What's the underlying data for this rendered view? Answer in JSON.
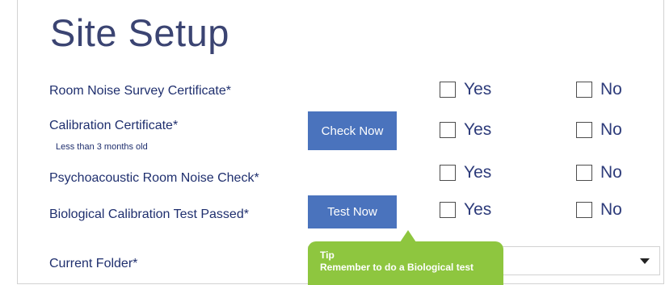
{
  "page": {
    "title": "Site Setup"
  },
  "rows": [
    {
      "label": "Room Noise Survey Certificate*",
      "yes": "Yes",
      "no": "No"
    },
    {
      "label": "Calibration Certificate*",
      "sublabel": "Less than 3 months old",
      "button": "Check Now",
      "yes": "Yes",
      "no": "No"
    },
    {
      "label": "Psychoacoustic Room Noise Check*",
      "yes": "Yes",
      "no": "No"
    },
    {
      "label": "Biological Calibration Test Passed*",
      "button": "Test Now",
      "yes": "Yes",
      "no": "No"
    }
  ],
  "folder": {
    "label": "Current Folder*",
    "value": ""
  },
  "tip": {
    "title": "Tip",
    "text": "Remember to do a Biological test"
  },
  "colors": {
    "label": "#1f2f6e",
    "button": "#4a73bd",
    "tip": "#8ec63f",
    "title": "#3b4472"
  }
}
